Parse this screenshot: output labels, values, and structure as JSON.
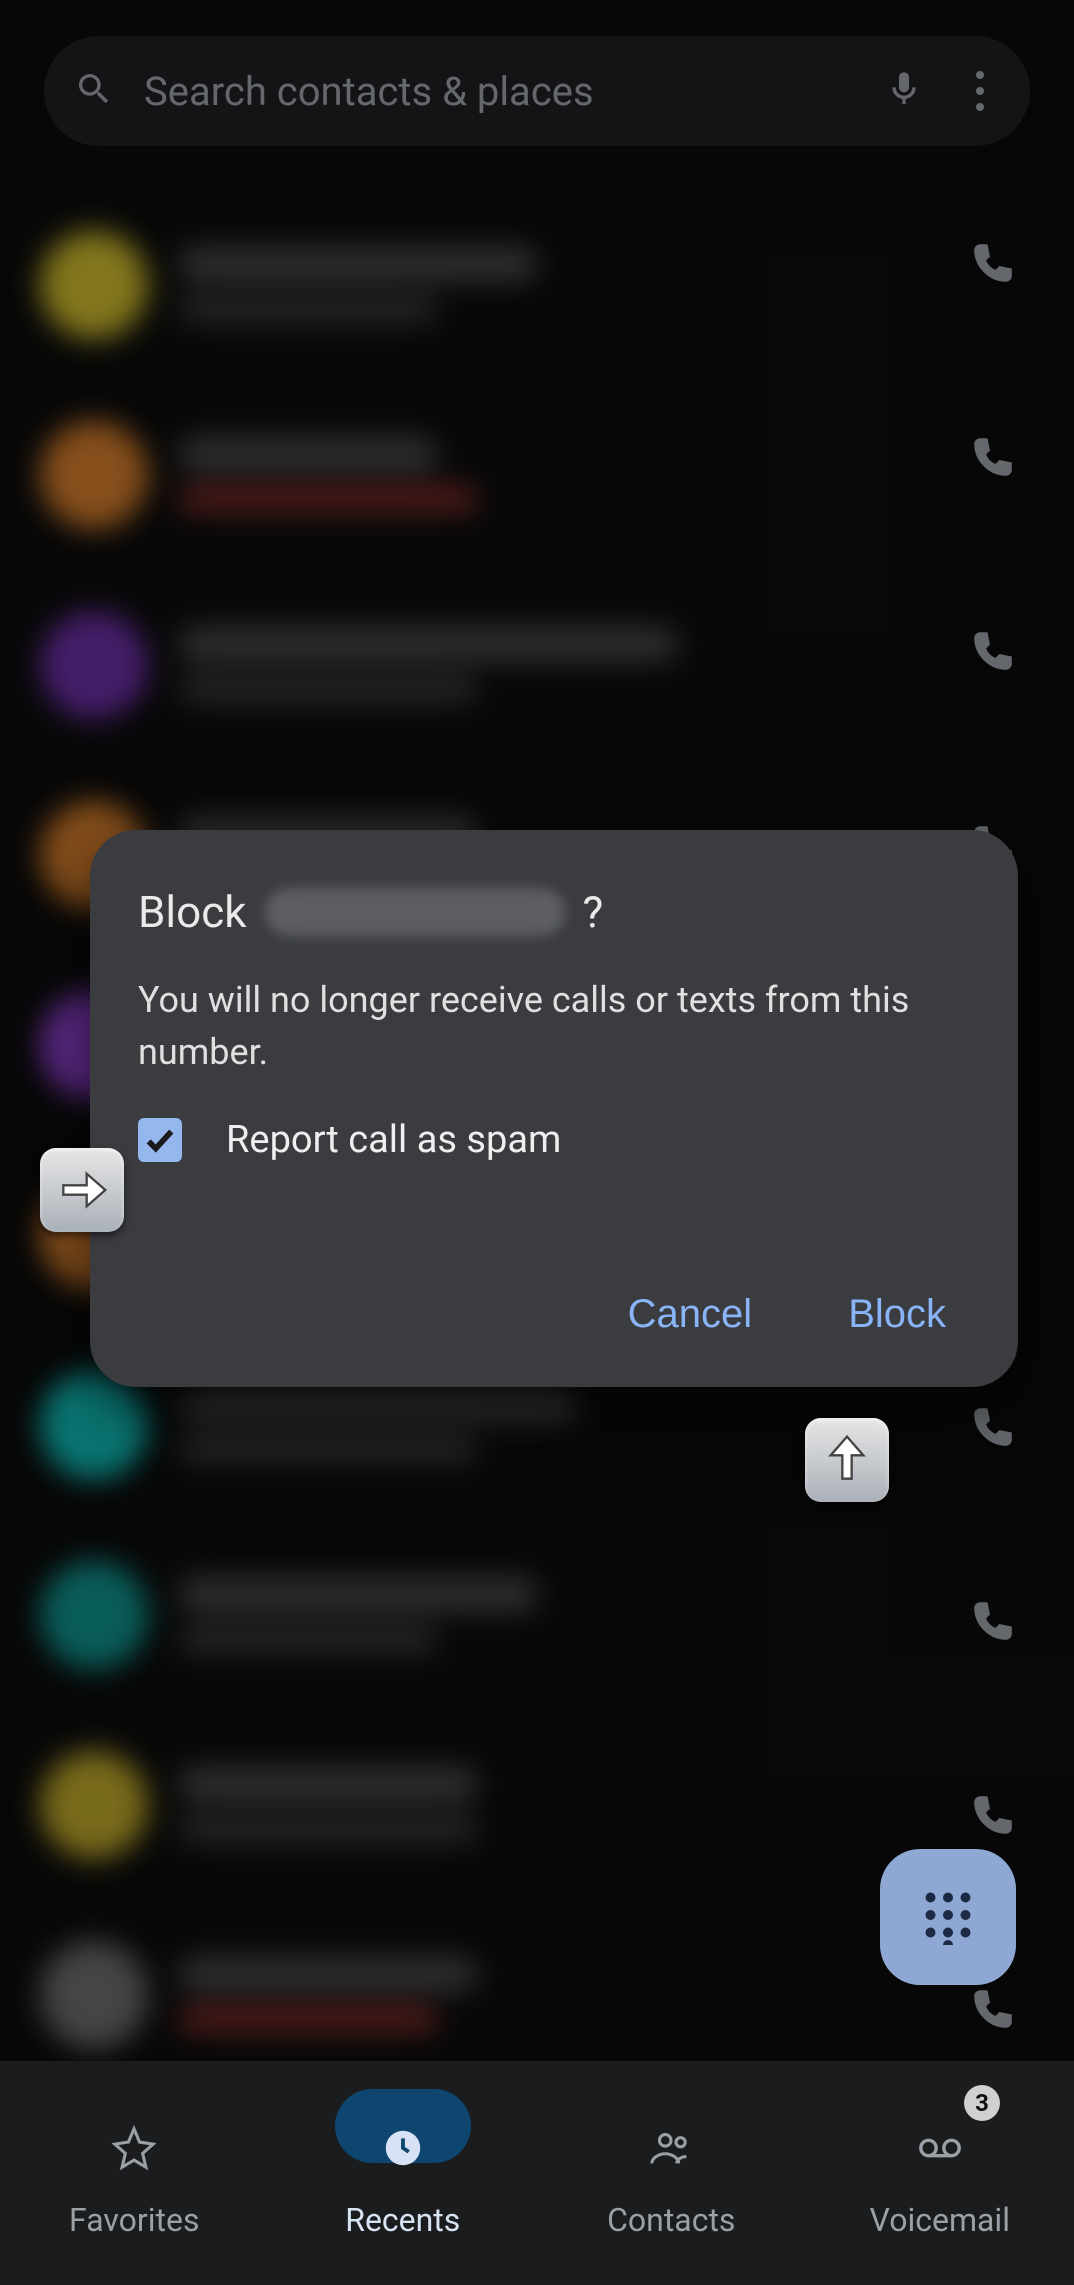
{
  "search": {
    "placeholder": "Search contacts & places"
  },
  "calls": [
    {
      "avatar_color": "#c9b62d"
    },
    {
      "avatar_color": "#cf7a2b"
    },
    {
      "avatar_color": "#6a2fa3"
    },
    {
      "avatar_color": "#cf7a2b"
    },
    {
      "avatar_color": "#8e3fcf"
    },
    {
      "avatar_color": "#cf7a2b"
    },
    {
      "avatar_color": "#0fb5b0"
    },
    {
      "avatar_color": "#0f8f8a"
    },
    {
      "avatar_color": "#b9a32a"
    },
    {
      "avatar_color": "#6a6a6a"
    }
  ],
  "modal": {
    "title_prefix": "Block",
    "title_suffix": "?",
    "body": "You will no longer receive calls or texts from this number.",
    "checkbox_label": "Report call as spam",
    "checkbox_checked": true,
    "cancel": "Cancel",
    "confirm": "Block"
  },
  "nav": {
    "items": [
      {
        "label": "Favorites"
      },
      {
        "label": "Recents"
      },
      {
        "label": "Contacts"
      },
      {
        "label": "Voicemail"
      }
    ],
    "active_index": 1,
    "voicemail_badge": "3"
  }
}
